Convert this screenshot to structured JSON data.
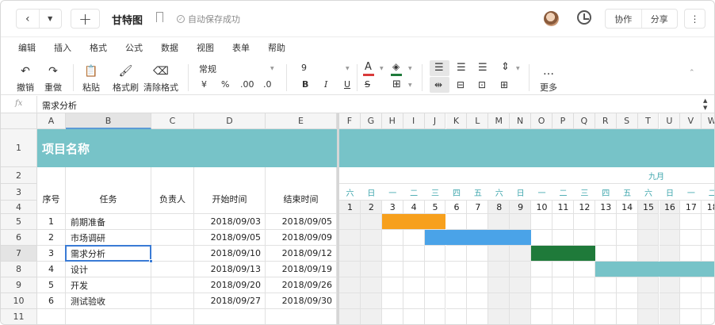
{
  "titlebar": {
    "back_icon": "chevron-left-icon",
    "doc_title": "甘特图",
    "save_status": "自动保存成功",
    "collab_label": "协作",
    "share_label": "分享",
    "more_label": "⋮"
  },
  "menu": [
    "编辑",
    "插入",
    "格式",
    "公式",
    "数据",
    "视图",
    "表单",
    "帮助"
  ],
  "toolbar": {
    "undo": "撤销",
    "redo": "重做",
    "paste": "粘贴",
    "format_painter": "格式刷",
    "clear_format": "清除格式",
    "number_format": "常规",
    "currency": "¥",
    "percent": "%",
    "dec_increase": ".00",
    "dec_decrease": ".0",
    "font_size": "9",
    "bold": "B",
    "italic": "I",
    "underline": "U",
    "strike": "S",
    "more": "更多",
    "font_color": "#d93a3a",
    "fill_color": "#1f7a3a"
  },
  "formula_bar": {
    "fx": "fx",
    "value": "需求分析"
  },
  "columns_left": [
    "A",
    "B",
    "C",
    "D",
    "E"
  ],
  "columns_right": [
    "F",
    "G",
    "H",
    "I",
    "J",
    "K",
    "L",
    "M",
    "N",
    "O",
    "P",
    "Q",
    "R",
    "S",
    "T",
    "U",
    "V",
    "W"
  ],
  "rows": [
    "1",
    "2",
    "3",
    "4",
    "5",
    "6",
    "7",
    "8",
    "9",
    "10",
    "11"
  ],
  "project_title": "项目名称",
  "table_headers": {
    "seq": "序号",
    "task": "任务",
    "owner": "负责人",
    "start": "开始时间",
    "end": "结束时间"
  },
  "tasks": [
    {
      "seq": "1",
      "task": "前期准备",
      "owner": "",
      "start": "2018/09/03",
      "end": "2018/09/05"
    },
    {
      "seq": "2",
      "task": "市场调研",
      "owner": "",
      "start": "2018/09/05",
      "end": "2018/09/09"
    },
    {
      "seq": "3",
      "task": "需求分析",
      "owner": "",
      "start": "2018/09/10",
      "end": "2018/09/12"
    },
    {
      "seq": "4",
      "task": "设计",
      "owner": "",
      "start": "2018/09/13",
      "end": "2018/09/19"
    },
    {
      "seq": "5",
      "task": "开发",
      "owner": "",
      "start": "2018/09/20",
      "end": "2018/09/26"
    },
    {
      "seq": "6",
      "task": "测试验收",
      "owner": "",
      "start": "2018/09/27",
      "end": "2018/09/30"
    }
  ],
  "gantt": {
    "month_label": "九月",
    "weekdays": [
      "六",
      "日",
      "一",
      "二",
      "三",
      "四",
      "五",
      "六",
      "日",
      "一",
      "二",
      "三",
      "四",
      "五",
      "六",
      "日",
      "一",
      "二"
    ],
    "days": [
      "1",
      "2",
      "3",
      "4",
      "5",
      "6",
      "7",
      "8",
      "9",
      "10",
      "11",
      "12",
      "13",
      "14",
      "15",
      "16",
      "17",
      "18"
    ],
    "bar_colors": [
      "#f7a01d",
      "#4aa3e8",
      "#1f7a3a",
      "#77c3c8",
      "#77c3c8",
      "#77c3c8"
    ],
    "title_band_color": "#77c3c8"
  },
  "selected_cell": "B7"
}
